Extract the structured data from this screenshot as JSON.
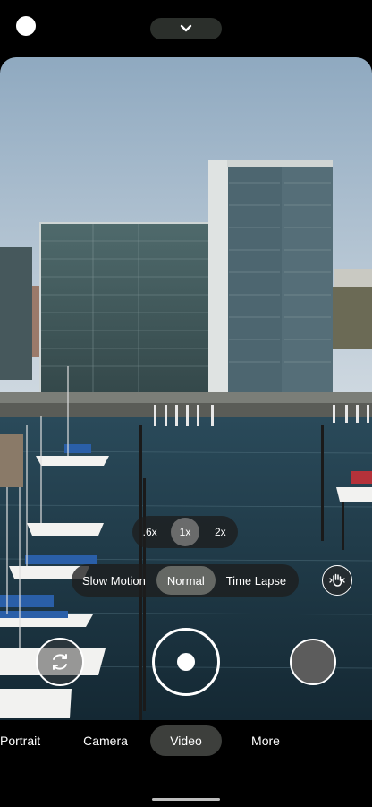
{
  "top": {
    "dot_icon": "status-dot-icon",
    "expand_icon": "chevron-down-icon"
  },
  "zoom": {
    "options": [
      ".6x",
      "1x",
      "2x"
    ],
    "selected": "1x"
  },
  "video_modes": {
    "options": [
      "Slow Motion",
      "Normal",
      "Time Lapse"
    ],
    "selected": "Normal"
  },
  "controls": {
    "stabilize_icon": "stabilization-hand-icon",
    "switch_icon": "camera-switch-icon",
    "shutter_icon": "record-button-icon"
  },
  "camera_tabs": {
    "items": [
      "Portrait",
      "Camera",
      "Video",
      "More"
    ],
    "selected": "Video"
  },
  "colors": {
    "pill_bg": "#2b2f2b",
    "active_tab": "#3d3f3c",
    "sky": "#aabccc",
    "water": "#1f3a4a"
  }
}
